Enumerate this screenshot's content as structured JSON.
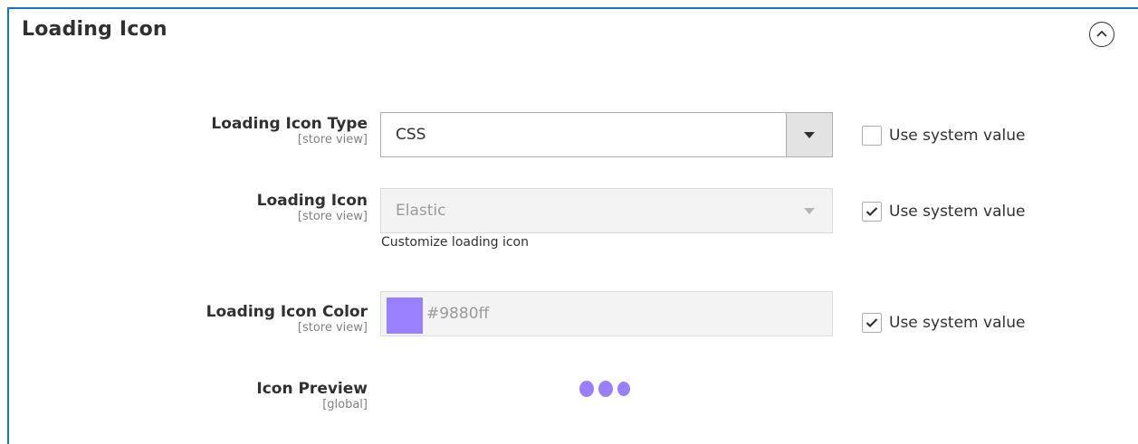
{
  "section": {
    "title": "Loading Icon",
    "collapse_icon": "chevron-up-circle-icon"
  },
  "fields": {
    "icon_type": {
      "label": "Loading Icon Type",
      "scope": "[store view]",
      "value": "CSS",
      "use_system_value": false,
      "use_system_label": "Use system value"
    },
    "icon": {
      "label": "Loading Icon",
      "scope": "[store view]",
      "value": "Elastic",
      "note": "Customize loading icon",
      "use_system_value": true,
      "use_system_label": "Use system value"
    },
    "icon_color": {
      "label": "Loading Icon Color",
      "scope": "[store view]",
      "value": "#9880ff",
      "use_system_value": true,
      "use_system_label": "Use system value"
    },
    "preview": {
      "label": "Icon Preview",
      "scope": "[global]"
    }
  },
  "colors": {
    "accent_border": "#0d7abf",
    "icon_color": "#9880ff"
  }
}
